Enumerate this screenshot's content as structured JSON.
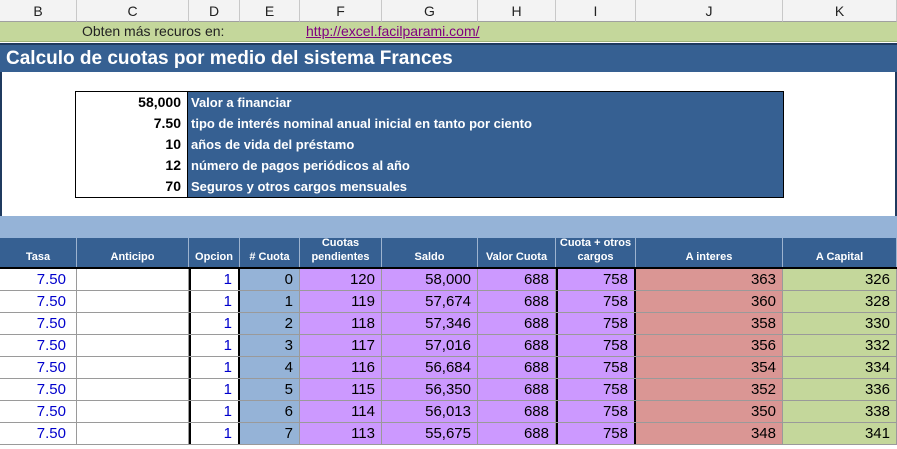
{
  "columns": [
    "B",
    "C",
    "D",
    "E",
    "F",
    "G",
    "H",
    "I",
    "J",
    "K"
  ],
  "link_row": {
    "label": "Obten más recuros en:",
    "url": "http://excel.facilparami.com/"
  },
  "title": "Calculo de cuotas por medio del sistema Frances",
  "params": [
    {
      "value": "58,000",
      "label": "Valor a financiar"
    },
    {
      "value": "7.50",
      "label": "tipo de interés nominal anual inicial en tanto por ciento"
    },
    {
      "value": "10",
      "label": "años de vida del préstamo"
    },
    {
      "value": "12",
      "label": "número de pagos periódicos al año"
    },
    {
      "value": "70",
      "label": "Seguros y otros cargos mensuales"
    }
  ],
  "table_headers": [
    "Tasa",
    "Anticipo",
    "Opcion",
    "# Cuota",
    "Cuotas pendientes",
    "Saldo",
    "Valor Cuota",
    "Cuota + otros cargos",
    "A interes",
    "A Capital"
  ],
  "rows": [
    [
      "7.50",
      "",
      "1",
      "0",
      "120",
      "58,000",
      "688",
      "758",
      "363",
      "326"
    ],
    [
      "7.50",
      "",
      "1",
      "1",
      "119",
      "57,674",
      "688",
      "758",
      "360",
      "328"
    ],
    [
      "7.50",
      "",
      "1",
      "2",
      "118",
      "57,346",
      "688",
      "758",
      "358",
      "330"
    ],
    [
      "7.50",
      "",
      "1",
      "3",
      "117",
      "57,016",
      "688",
      "758",
      "356",
      "332"
    ],
    [
      "7.50",
      "",
      "1",
      "4",
      "116",
      "56,684",
      "688",
      "758",
      "354",
      "334"
    ],
    [
      "7.50",
      "",
      "1",
      "5",
      "115",
      "56,350",
      "688",
      "758",
      "352",
      "336"
    ],
    [
      "7.50",
      "",
      "1",
      "6",
      "114",
      "56,013",
      "688",
      "758",
      "350",
      "338"
    ],
    [
      "7.50",
      "",
      "1",
      "7",
      "113",
      "55,675",
      "688",
      "758",
      "348",
      "341"
    ]
  ]
}
